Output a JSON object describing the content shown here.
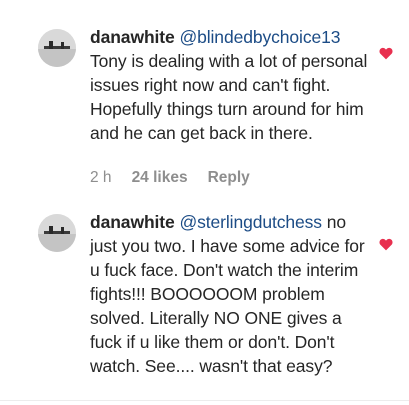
{
  "comments": [
    {
      "username": "danawhite",
      "mention": "@blindedbychoice13",
      "text": "Tony is dealing with a lot of personal issues right now and can't fight. Hopefully things turn around for him and he can get back in there.",
      "time": "2 h",
      "likes": "24 likes",
      "reply_label": "Reply",
      "like_icon": "heart-icon",
      "like_color": "#e8304f"
    },
    {
      "username": "danawhite",
      "mention": "@sterlingdutchess",
      "text": "no just you two. I have some advice for u fuck face. Don't watch the interim fights!!! BOOOOOOM problem solved. Literally NO ONE gives a fuck if u like them or don't. Don't watch. See.... wasn't that easy?",
      "like_icon": "heart-icon",
      "like_color": "#e8304f"
    }
  ]
}
